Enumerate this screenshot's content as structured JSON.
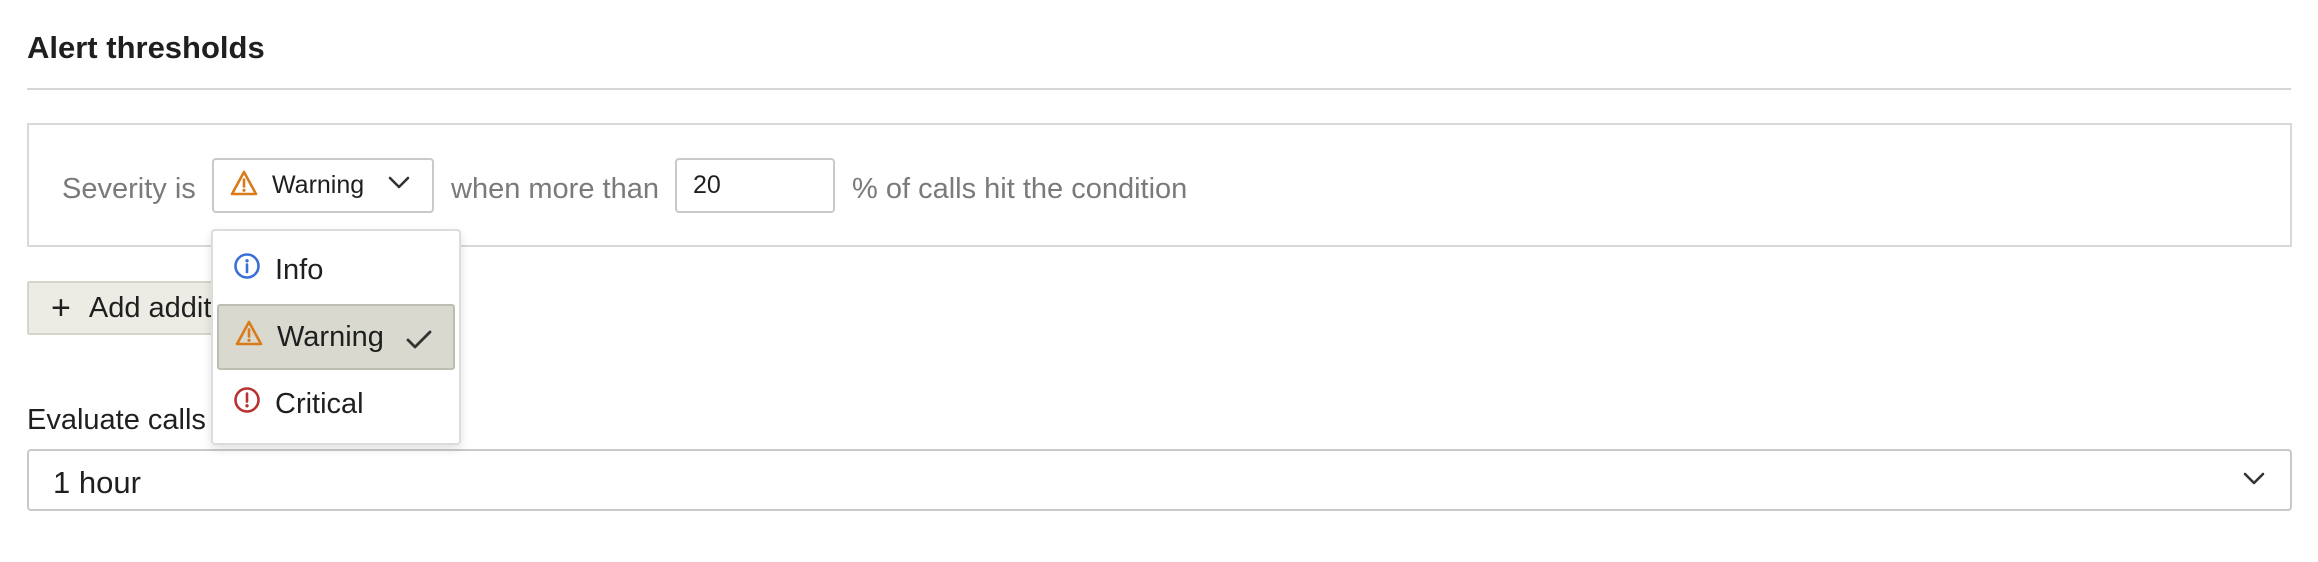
{
  "section": {
    "title": "Alert thresholds"
  },
  "threshold": {
    "prefix": "Severity is",
    "severity_value": "Warning",
    "middle": "when more than",
    "percent_value": "20",
    "suffix": "% of calls hit the condition"
  },
  "add_button": {
    "label": "Add additional threshold"
  },
  "evaluate": {
    "label": "Evaluate calls over",
    "value": "1 hour"
  },
  "dropdown": {
    "options": [
      {
        "label": "Info",
        "icon": "info-icon",
        "color": "#3a6fd8"
      },
      {
        "label": "Warning",
        "icon": "warning-icon",
        "color": "#d97b1a",
        "selected": true
      },
      {
        "label": "Critical",
        "icon": "critical-icon",
        "color": "#b83232"
      }
    ]
  },
  "colors": {
    "info": "#3a6fd8",
    "warning": "#d97b1a",
    "critical": "#b83232",
    "selected_bg": "#d9d9cf",
    "button_bg": "#ecece4"
  }
}
